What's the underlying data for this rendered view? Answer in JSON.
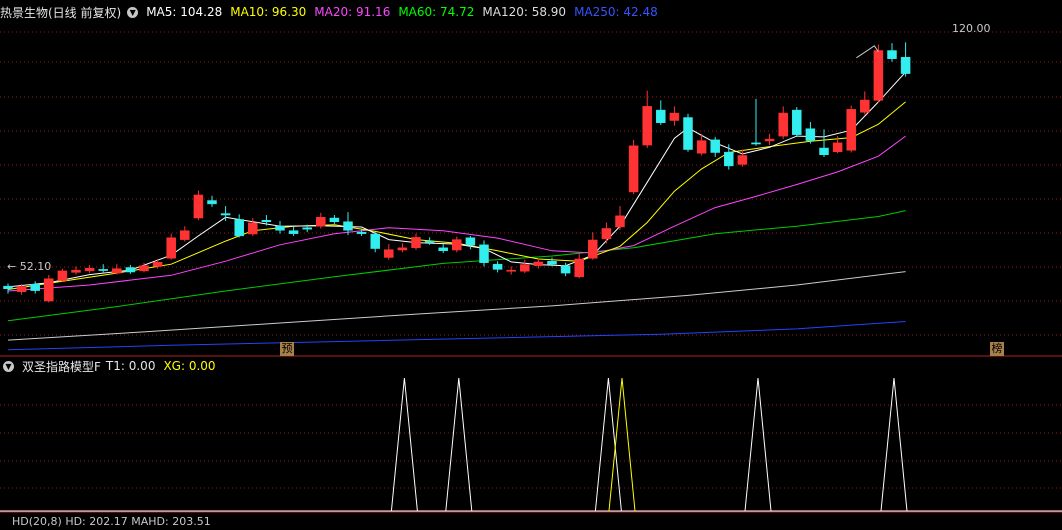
{
  "main_header": {
    "stock_name": "热景生物(日线 前复权)",
    "indicators": [
      {
        "label": "MA5: 104.28",
        "color": "#ffffff"
      },
      {
        "label": "MA10: 96.30",
        "color": "#ffff00"
      },
      {
        "label": "MA20: 91.16",
        "color": "#ff44ff"
      },
      {
        "label": "MA60: 74.72",
        "color": "#00ff00"
      },
      {
        "label": "MA120: 58.90",
        "color": "#dddddd"
      },
      {
        "label": "MA250: 42.48",
        "color": "#3355ff"
      }
    ]
  },
  "price_labels": {
    "high": "120.00",
    "low": "52.10"
  },
  "badges": {
    "left": "预",
    "right": "榜"
  },
  "sub_header": {
    "title": "双圣指路模型F",
    "t1": "T1: 0.00",
    "xg": "XG: 0.00"
  },
  "bottom_header": {
    "text": "HD(20,8)  HD: 202.17  MAHD: 203.51"
  },
  "colors": {
    "up": "#ff3333",
    "down": "#33eeee",
    "grid": "#8b1a1a",
    "ma5": "#ffffff",
    "ma10": "#ffff00",
    "ma20": "#ff44ff",
    "ma60": "#00cc00",
    "ma120": "#cccccc",
    "ma250": "#2244ff"
  },
  "chart_data": [
    {
      "type": "candlestick",
      "title": "热景生物(日线 前复权)",
      "ylim": [
        38,
        128
      ],
      "annotations": [
        {
          "text": "120.00",
          "value": 120.0
        },
        {
          "text": "52.10",
          "value": 52.1
        }
      ],
      "candles": [
        [
          56.5,
          55.8,
          57.2,
          54.5
        ],
        [
          55.0,
          56.4,
          57.0,
          54.2
        ],
        [
          57.0,
          55.3,
          57.8,
          54.5
        ],
        [
          52.5,
          58.5,
          59.5,
          52.1
        ],
        [
          58.0,
          60.6,
          61.2,
          57.6
        ],
        [
          60.2,
          60.8,
          61.8,
          59.6
        ],
        [
          60.6,
          61.3,
          62.2,
          60.0
        ],
        [
          61.0,
          60.7,
          62.4,
          60.2
        ],
        [
          60.0,
          61.2,
          62.4,
          59.6
        ],
        [
          61.5,
          60.3,
          62.2,
          59.8
        ],
        [
          60.6,
          62.0,
          62.8,
          60.2
        ],
        [
          61.8,
          62.9,
          63.8,
          61.2
        ],
        [
          64.0,
          69.5,
          70.6,
          63.6
        ],
        [
          69.0,
          71.4,
          72.6,
          68.5
        ],
        [
          74.8,
          81.0,
          82.2,
          74.2
        ],
        [
          79.5,
          78.6,
          80.8,
          77.8
        ],
        [
          76.0,
          75.6,
          78.0,
          74.0
        ],
        [
          74.4,
          70.0,
          75.8,
          69.6
        ],
        [
          70.5,
          73.5,
          74.8,
          70.0
        ],
        [
          74.2,
          73.8,
          75.6,
          72.8
        ],
        [
          72.6,
          71.5,
          74.0,
          70.6
        ],
        [
          71.4,
          70.6,
          72.4,
          70.0
        ],
        [
          72.2,
          71.8,
          73.0,
          71.0
        ],
        [
          72.6,
          75.0,
          76.2,
          72.0
        ],
        [
          74.8,
          73.8,
          75.6,
          73.2
        ],
        [
          73.8,
          71.5,
          76.4,
          70.2
        ],
        [
          71.0,
          70.6,
          72.0,
          70.0
        ],
        [
          70.5,
          66.6,
          71.2,
          65.6
        ],
        [
          64.2,
          66.3,
          67.8,
          63.6
        ],
        [
          66.2,
          66.8,
          68.0,
          65.6
        ],
        [
          66.8,
          69.6,
          70.6,
          66.2
        ],
        [
          68.6,
          68.2,
          69.6,
          67.6
        ],
        [
          66.8,
          66.0,
          67.8,
          65.4
        ],
        [
          66.2,
          69.0,
          69.8,
          65.6
        ],
        [
          69.5,
          67.5,
          70.0,
          66.4
        ],
        [
          67.6,
          62.8,
          68.8,
          61.8
        ],
        [
          62.4,
          61.0,
          63.2,
          60.2
        ],
        [
          60.6,
          60.8,
          61.8,
          59.6
        ],
        [
          60.5,
          62.3,
          63.6,
          60.0
        ],
        [
          62.0,
          63.0,
          63.8,
          61.2
        ],
        [
          63.2,
          62.4,
          64.2,
          61.8
        ],
        [
          62.0,
          60.0,
          62.8,
          59.2
        ],
        [
          59.0,
          63.8,
          65.2,
          58.6
        ],
        [
          64.0,
          68.9,
          71.0,
          63.6
        ],
        [
          69.2,
          72.0,
          73.6,
          68.0
        ],
        [
          72.4,
          75.4,
          78.0,
          71.6
        ],
        [
          81.8,
          94.2,
          95.8,
          81.2
        ],
        [
          94.4,
          104.8,
          109.0,
          93.6
        ],
        [
          103.8,
          100.4,
          106.4,
          99.8
        ],
        [
          101.0,
          103.0,
          104.8,
          99.6
        ],
        [
          101.8,
          93.2,
          102.8,
          92.6
        ],
        [
          92.2,
          95.6,
          97.4,
          91.6
        ],
        [
          95.8,
          92.4,
          96.6,
          91.2
        ],
        [
          92.5,
          88.8,
          94.6,
          87.8
        ],
        [
          89.2,
          91.6,
          93.2,
          88.6
        ],
        [
          95.0,
          94.8,
          106.8,
          94.2
        ],
        [
          95.5,
          96.0,
          97.4,
          94.4
        ],
        [
          96.8,
          103.0,
          104.8,
          96.0
        ],
        [
          103.8,
          97.2,
          104.6,
          96.6
        ],
        [
          98.8,
          95.6,
          100.6,
          94.8
        ],
        [
          93.6,
          91.8,
          98.6,
          91.2
        ],
        [
          92.6,
          95.0,
          96.8,
          92.2
        ],
        [
          93.0,
          104.0,
          105.0,
          92.4
        ],
        [
          103.2,
          106.5,
          108.8,
          102.6
        ],
        [
          106.4,
          119.8,
          121.4,
          105.8
        ],
        [
          119.8,
          117.6,
          121.8,
          116.8
        ],
        [
          118.0,
          113.6,
          122.0,
          112.8
        ]
      ],
      "ma5": [
        [
          0,
          56.3
        ],
        [
          3,
          57.4
        ],
        [
          6,
          59.6
        ],
        [
          9,
          60.8
        ],
        [
          12,
          64.8
        ],
        [
          14,
          70.0
        ],
        [
          16,
          75.0
        ],
        [
          18,
          73.8
        ],
        [
          20,
          72.6
        ],
        [
          23,
          72.7
        ],
        [
          26,
          72.4
        ],
        [
          28,
          69.0
        ],
        [
          30,
          68.2
        ],
        [
          33,
          67.8
        ],
        [
          35,
          66.6
        ],
        [
          37,
          63.0
        ],
        [
          39,
          62.3
        ],
        [
          41,
          62.0
        ],
        [
          43,
          64.8
        ],
        [
          45,
          72.6
        ],
        [
          47,
          84.4
        ],
        [
          49,
          96.2
        ],
        [
          50,
          99.0
        ],
        [
          52,
          95.0
        ],
        [
          54,
          92.0
        ],
        [
          56,
          93.8
        ],
        [
          58,
          96.8
        ],
        [
          60,
          96.6
        ],
        [
          62,
          98.4
        ],
        [
          64,
          106.0
        ],
        [
          66,
          114.0
        ]
      ],
      "ma10": [
        [
          0,
          55.6
        ],
        [
          4,
          57.8
        ],
        [
          8,
          60.0
        ],
        [
          12,
          62.4
        ],
        [
          16,
          68.6
        ],
        [
          18,
          71.4
        ],
        [
          21,
          72.6
        ],
        [
          24,
          73.0
        ],
        [
          27,
          71.2
        ],
        [
          30,
          69.0
        ],
        [
          33,
          68.0
        ],
        [
          36,
          66.0
        ],
        [
          39,
          63.8
        ],
        [
          42,
          63.2
        ],
        [
          45,
          67.2
        ],
        [
          47,
          73.6
        ],
        [
          49,
          82.0
        ],
        [
          51,
          88.0
        ],
        [
          53,
          92.4
        ],
        [
          56,
          94.0
        ],
        [
          59,
          95.4
        ],
        [
          62,
          96.4
        ],
        [
          64,
          100.0
        ],
        [
          66,
          106.0
        ]
      ],
      "ma20": [
        [
          0,
          55.2
        ],
        [
          6,
          56.8
        ],
        [
          12,
          59.4
        ],
        [
          16,
          63.2
        ],
        [
          20,
          67.6
        ],
        [
          24,
          70.6
        ],
        [
          28,
          72.2
        ],
        [
          32,
          71.4
        ],
        [
          36,
          69.4
        ],
        [
          40,
          66.0
        ],
        [
          43,
          65.4
        ],
        [
          46,
          67.4
        ],
        [
          49,
          72.6
        ],
        [
          52,
          77.6
        ],
        [
          55,
          80.6
        ],
        [
          58,
          83.8
        ],
        [
          61,
          87.2
        ],
        [
          64,
          91.4
        ],
        [
          66,
          96.8
        ]
      ],
      "ma60": [
        [
          0,
          47.2
        ],
        [
          8,
          51.0
        ],
        [
          16,
          55.2
        ],
        [
          24,
          59.0
        ],
        [
          32,
          62.6
        ],
        [
          40,
          64.6
        ],
        [
          46,
          66.8
        ],
        [
          52,
          70.6
        ],
        [
          58,
          72.6
        ],
        [
          64,
          75.2
        ],
        [
          66,
          76.8
        ]
      ],
      "ma120": [
        [
          0,
          42.0
        ],
        [
          10,
          44.2
        ],
        [
          20,
          46.6
        ],
        [
          30,
          49.0
        ],
        [
          40,
          51.2
        ],
        [
          50,
          54.0
        ],
        [
          58,
          56.8
        ],
        [
          66,
          60.4
        ]
      ],
      "ma250": [
        [
          0,
          39.4
        ],
        [
          12,
          40.6
        ],
        [
          24,
          41.6
        ],
        [
          36,
          42.6
        ],
        [
          48,
          43.6
        ],
        [
          58,
          45.0
        ],
        [
          66,
          47.0
        ]
      ]
    },
    {
      "type": "line",
      "title": "双圣指路模型F",
      "ylim": [
        0,
        1
      ],
      "t1_peaks": [
        29,
        33,
        44,
        55,
        65
      ],
      "xg_peaks": [
        45
      ]
    }
  ]
}
